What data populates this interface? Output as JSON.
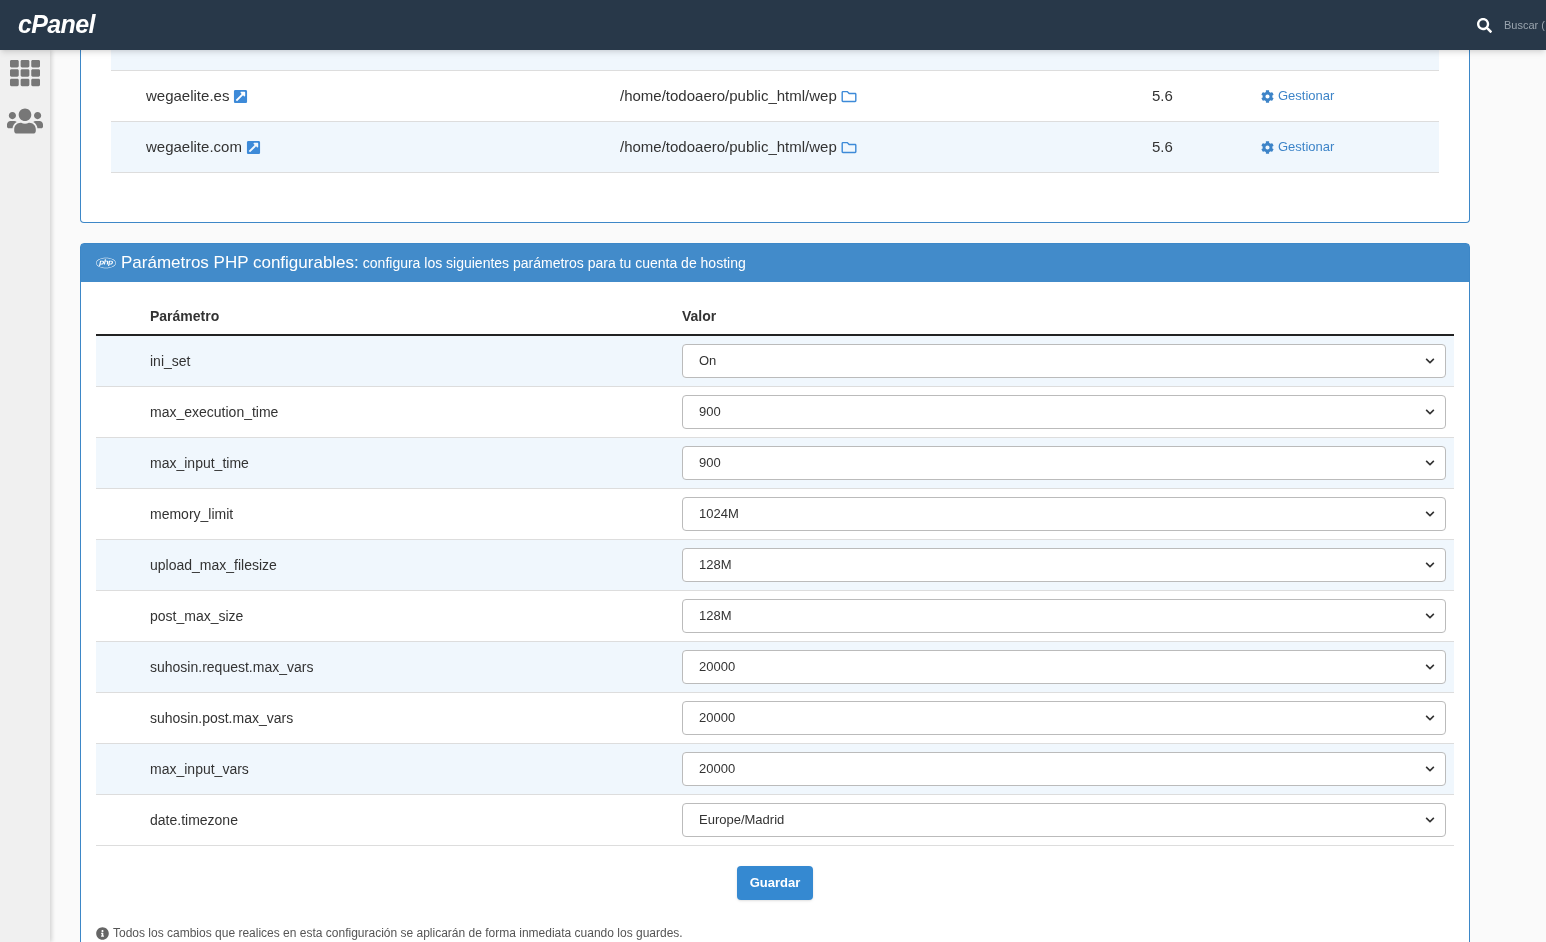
{
  "header": {
    "logo": "cPanel",
    "search": {
      "placeholder": "Buscar ("
    }
  },
  "domains": {
    "rows": [
      {
        "domain": "wegaelite.es",
        "path": "/home/todoaero/public_html/wep",
        "version": "5.6",
        "action": "Gestionar"
      },
      {
        "domain": "wegaelite.com",
        "path": "/home/todoaero/public_html/wep",
        "version": "5.6",
        "action": "Gestionar"
      }
    ]
  },
  "php_panel": {
    "title": "Parámetros PHP configurables:",
    "subtitle": "configura los siguientes parámetros para tu cuenta de hosting",
    "columns": [
      "Parámetro",
      "Valor"
    ],
    "rows": [
      {
        "parameter": "ini_set",
        "value": "On"
      },
      {
        "parameter": "max_execution_time",
        "value": "900"
      },
      {
        "parameter": "max_input_time",
        "value": "900"
      },
      {
        "parameter": "memory_limit",
        "value": "1024M"
      },
      {
        "parameter": "upload_max_filesize",
        "value": "128M"
      },
      {
        "parameter": "post_max_size",
        "value": "128M"
      },
      {
        "parameter": "suhosin.request.max_vars",
        "value": "20000"
      },
      {
        "parameter": "suhosin.post.max_vars",
        "value": "20000"
      },
      {
        "parameter": "max_input_vars",
        "value": "20000"
      },
      {
        "parameter": "date.timezone",
        "value": "Europe/Madrid"
      }
    ],
    "save_button": "Guardar",
    "note": "Todos los cambios que realices en esta configuración se aplicarán de forma inmediata cuando los guardes."
  }
}
